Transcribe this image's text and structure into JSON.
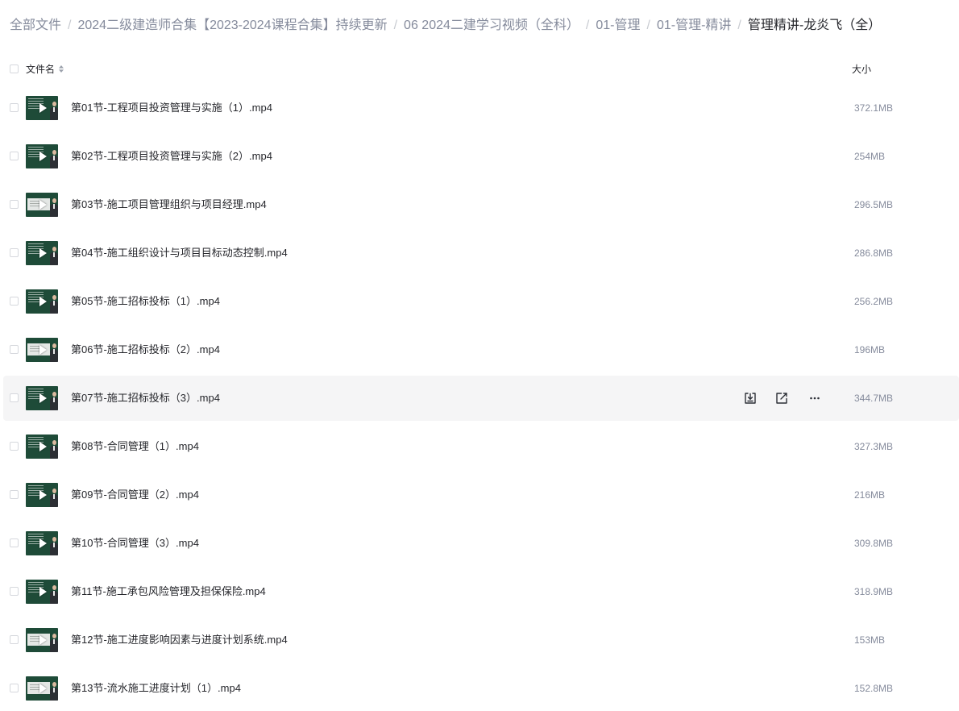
{
  "breadcrumb": {
    "separator": "/",
    "items": [
      "全部文件",
      "2024二级建造师合集【2023-2024课程合集】持续更新",
      "06 2024二建学习视频（全科）",
      "01-管理",
      "01-管理-精讲",
      "管理精讲-龙炎飞（全）"
    ]
  },
  "table": {
    "columns": {
      "name": "文件名",
      "size": "大小"
    },
    "sort_icon": "sort-icon"
  },
  "file_icon": "play-icon",
  "files": [
    {
      "name": "第01节-工程项目投资管理与实施（1）.mp4",
      "size": "372.1MB"
    },
    {
      "name": "第02节-工程项目投资管理与实施（2）.mp4",
      "size": "254MB"
    },
    {
      "name": "第03节-施工项目管理组织与项目经理.mp4",
      "size": "296.5MB"
    },
    {
      "name": "第04节-施工组织设计与项目目标动态控制.mp4",
      "size": "286.8MB"
    },
    {
      "name": "第05节-施工招标投标（1）.mp4",
      "size": "256.2MB"
    },
    {
      "name": "第06节-施工招标投标（2）.mp4",
      "size": "196MB"
    },
    {
      "name": "第07节-施工招标投标（3）.mp4",
      "size": "344.7MB",
      "hovered": true,
      "actions": [
        "download-icon",
        "share-icon",
        "more-icon"
      ]
    },
    {
      "name": "第08节-合同管理（1）.mp4",
      "size": "327.3MB"
    },
    {
      "name": "第09节-合同管理（2）.mp4",
      "size": "216MB"
    },
    {
      "name": "第10节-合同管理（3）.mp4",
      "size": "309.8MB"
    },
    {
      "name": "第11节-施工承包风险管理及担保保险.mp4",
      "size": "318.9MB"
    },
    {
      "name": "第12节-施工进度影响因素与进度计划系统.mp4",
      "size": "153MB"
    },
    {
      "name": "第13节-流水施工进度计划（1）.mp4",
      "size": "152.8MB"
    }
  ],
  "colors": {
    "text": "#25262b",
    "muted": "#858b9c",
    "hover_background": "#f5f5f6",
    "thumbnail": "#1e4b38"
  }
}
